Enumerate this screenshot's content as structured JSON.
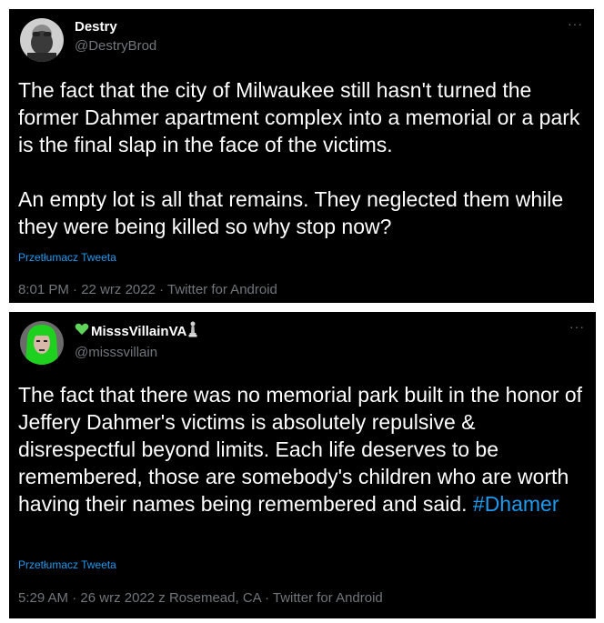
{
  "tweets": [
    {
      "display_name": "Destry",
      "handle": "@DestryBrod",
      "more": "···",
      "text": "The fact that the city of Milwaukee still hasn't turned the former Dahmer apartment complex into a memorial or a park is the final slap in the face of the victims.\n\nAn empty lot is all that remains. They neglected them while they were being killed so why stop now?",
      "translate": "Przetłumacz Tweeta",
      "time": "8:01 PM",
      "sep1": " · ",
      "date": "22 wrz 2022",
      "sep2": " · ",
      "source": "Twitter for Android"
    },
    {
      "display_name": "MisssVillainVA",
      "handle": "@misssvillain",
      "more": "···",
      "text": "The fact that there was no memorial park built in the honor of Jeffery Dahmer's victims is absolutely repulsive & disrespectful beyond limits. Each life deserves to be remembered, those are somebody's children who are worth having their names being remembered and said. ",
      "hashtag": "#Dhamer",
      "translate": "Przetłumacz Tweeta",
      "time": "5:29 AM",
      "sep1": " · ",
      "date": "26 wrz 2022 z Rosemead, CA",
      "sep2": " · ",
      "source": "Twitter for Android"
    }
  ],
  "colors": {
    "background": "#000000",
    "text": "#ffffff",
    "secondary": "#71767b",
    "link": "#1d9bf0",
    "heart": "#5fd35a"
  },
  "icons": {
    "heart": "green-heart-icon",
    "pawn": "chess-pawn-icon",
    "more": "more-options-icon"
  }
}
